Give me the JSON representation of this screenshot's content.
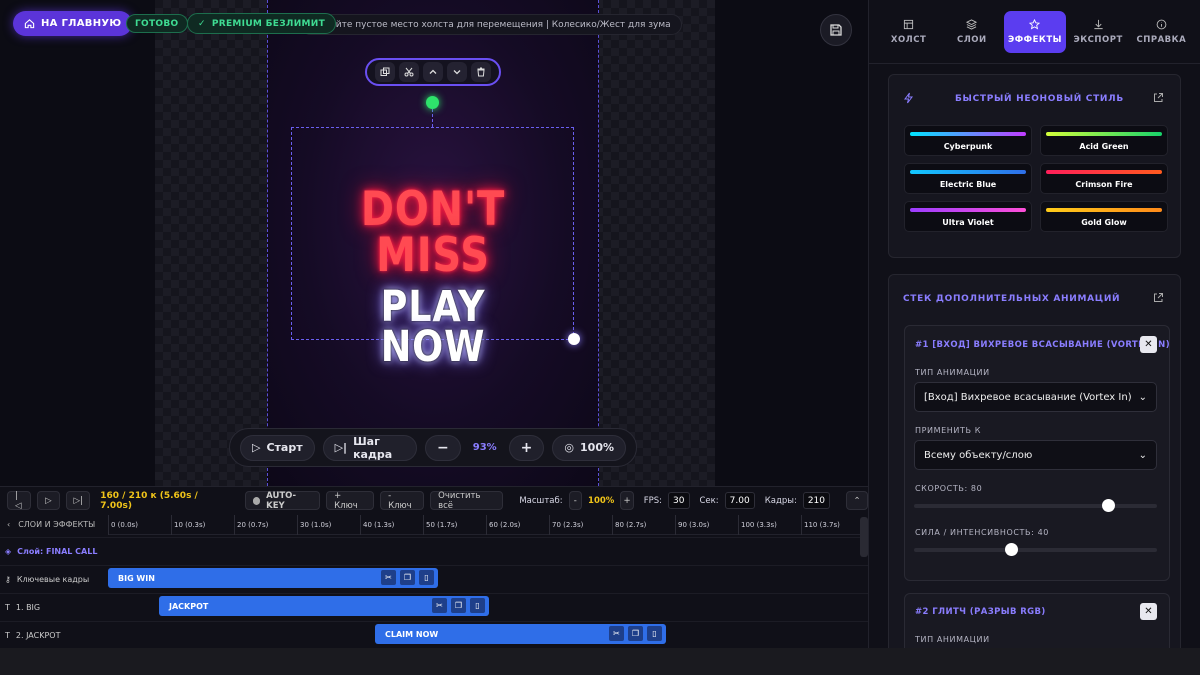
{
  "header": {
    "home_label": "НА ГЛАВНУЮ",
    "status_ready": "ГОТОВО",
    "premium_label": "PREMIUM БЕЗЛИМИТ",
    "hint": "живайте пустое место холста для перемещения | Колесико/Жест для зума"
  },
  "canvas": {
    "line1": "DON'T",
    "line2": "MISS",
    "line3": "PLAY",
    "line4": "NOW"
  },
  "playback": {
    "start_label": "Старт",
    "step_label": "Шаг кадра",
    "minus": "−",
    "zoom": "93%",
    "plus": "+",
    "fit_label": "100%"
  },
  "tabs": [
    {
      "label": "ХОЛСТ",
      "icon": "canvas-icon"
    },
    {
      "label": "СЛОИ",
      "icon": "layers-icon"
    },
    {
      "label": "ЭФФЕКТЫ",
      "icon": "star-icon"
    },
    {
      "label": "ЭКСПОРТ",
      "icon": "download-icon"
    },
    {
      "label": "СПРАВКА",
      "icon": "info-icon"
    }
  ],
  "neon_style": {
    "title": "БЫСТРЫЙ НЕОНОВЫЙ СТИЛЬ",
    "presets": [
      {
        "label": "Cyberpunk",
        "color1": "#00e5ff",
        "color2": "#c23cff"
      },
      {
        "label": "Acid Green",
        "color1": "#d4ff3a",
        "color2": "#17d36b"
      },
      {
        "label": "Electric Blue",
        "color1": "#12c8ff",
        "color2": "#2f6ee8"
      },
      {
        "label": "Crimson Fire",
        "color1": "#ff1e5a",
        "color2": "#ff5a1e"
      },
      {
        "label": "Ultra Violet",
        "color1": "#9b3dff",
        "color2": "#ff4fd8"
      },
      {
        "label": "Gold Glow",
        "color1": "#ffcc1a",
        "color2": "#ff8a1a"
      }
    ]
  },
  "anim_stack": {
    "title": "СТЕК ДОПОЛНИТЕЛЬНЫХ АНИМАЦИЙ",
    "item1": {
      "title": "#1 [ВХОД] ВИХРЕВОЕ ВСАСЫВАНИЕ (VORTEX IN)",
      "type_label": "ТИП АНИМАЦИИ",
      "type_value": "[Вход] Вихревое всасывание (Vortex In)",
      "apply_label": "ПРИМЕНИТЬ К",
      "apply_value": "Всему объекту/слою",
      "speed_label": "СКОРОСТЬ: 80",
      "speed": 80,
      "intensity_label": "СИЛА / ИНТЕНСИВНОСТЬ: 40",
      "intensity": 40
    },
    "item2": {
      "title": "#2 ГЛИТЧ (РАЗРЫВ RGB)",
      "type_label": "ТИП АНИМАЦИИ"
    }
  },
  "timeline": {
    "frame_readout": "160 / 210 к (5.60s / 7.00s)",
    "autokey": "AUTO-KEY",
    "add_key": "+ Ключ",
    "remove_key": "- Ключ",
    "clear_all": "Очистить всё",
    "scale_label": "Масштаб:",
    "scale_minus": "-",
    "scale_value": "100%",
    "scale_plus": "+",
    "fps_label": "FPS:",
    "fps_value": "30",
    "sec_label": "Сек:",
    "sec_value": "7.00",
    "frames_label": "Кадры:",
    "frames_value": "210",
    "layers_header": "СЛОИ И ЭФФЕКТЫ",
    "ticks": [
      "0 (0.0s)",
      "10 (0.3s)",
      "20 (0.7s)",
      "30 (1.0s)",
      "40 (1.3s)",
      "50 (1.7s)",
      "60 (2.0s)",
      "70 (2.3s)",
      "80 (2.7s)",
      "90 (3.0s)",
      "100 (3.3s)",
      "110 (3.7s)"
    ],
    "layer_row": "Слой: FINAL CALL",
    "rows": [
      {
        "label": "Ключевые кадры",
        "clip": "BIG WIN"
      },
      {
        "label": "1. BIG",
        "clip": "JACKPOT"
      },
      {
        "label": "2. JACKPOT",
        "clip": "CLAIM NOW"
      }
    ]
  },
  "colors": {
    "accent": "#5b3df0",
    "neon_red": "#ff4a52",
    "clip_blue": "#2f6ee8",
    "success": "#3fdc93"
  }
}
